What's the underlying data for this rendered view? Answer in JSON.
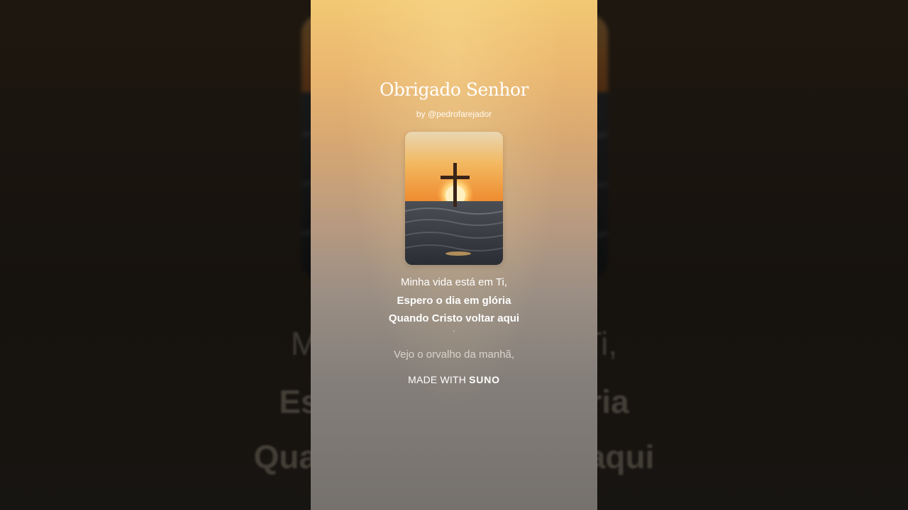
{
  "song": {
    "title": "Obrigado Senhor",
    "byline": "by @pedrofarejador"
  },
  "lyrics": {
    "line1": "Minha vida está em Ti,",
    "line2": "Espero o dia em glória",
    "line3": "Quando Cristo voltar aqui",
    "dot": ".",
    "next": "Vejo o orvalho da manhã,"
  },
  "background_lyrics": {
    "line1": "Minha vida está em Ti,",
    "line2": "Espero o dia em glória",
    "line3": "Quando Cristo voltar aqui"
  },
  "branding": {
    "prefix": "MADE WITH",
    "name": "SUNO"
  },
  "cover": {
    "icon": "cross-sunset-icon"
  },
  "colors": {
    "panel_top": "#f2c873",
    "panel_bottom": "#75716d",
    "text": "#ffffff"
  }
}
